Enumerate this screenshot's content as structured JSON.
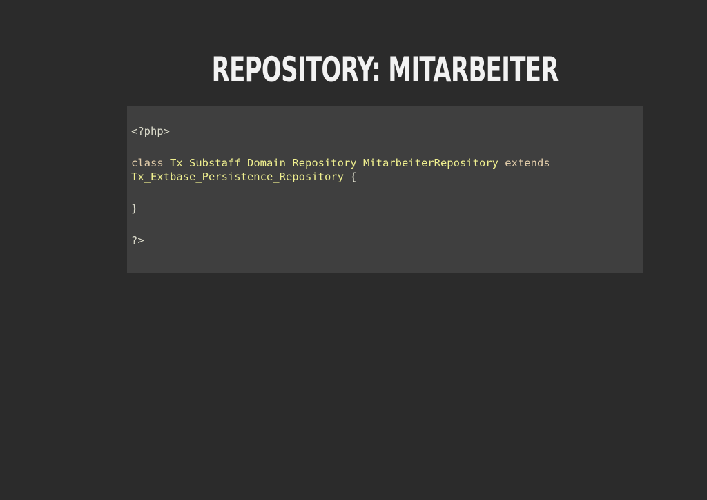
{
  "slide": {
    "title": "REPOSITORY: MITARBEITER"
  },
  "code": {
    "language": "php",
    "line1": "<?php>",
    "line3_keyword": "class",
    "line3_classname": "Tx_Substaff_Domain_Repository_MitarbeiterRepository",
    "line3_extends": "extends",
    "line4_parent": "Tx_Extbase_Persistence_Repository",
    "line4_brace": "{",
    "line6": "}",
    "line8": "?>"
  },
  "colors": {
    "background": "#2b2b2b",
    "code_background": "#3f3f3f",
    "title": "#f2f2f2",
    "code_text": "#dcdccc",
    "class_name": "#efef8f"
  }
}
